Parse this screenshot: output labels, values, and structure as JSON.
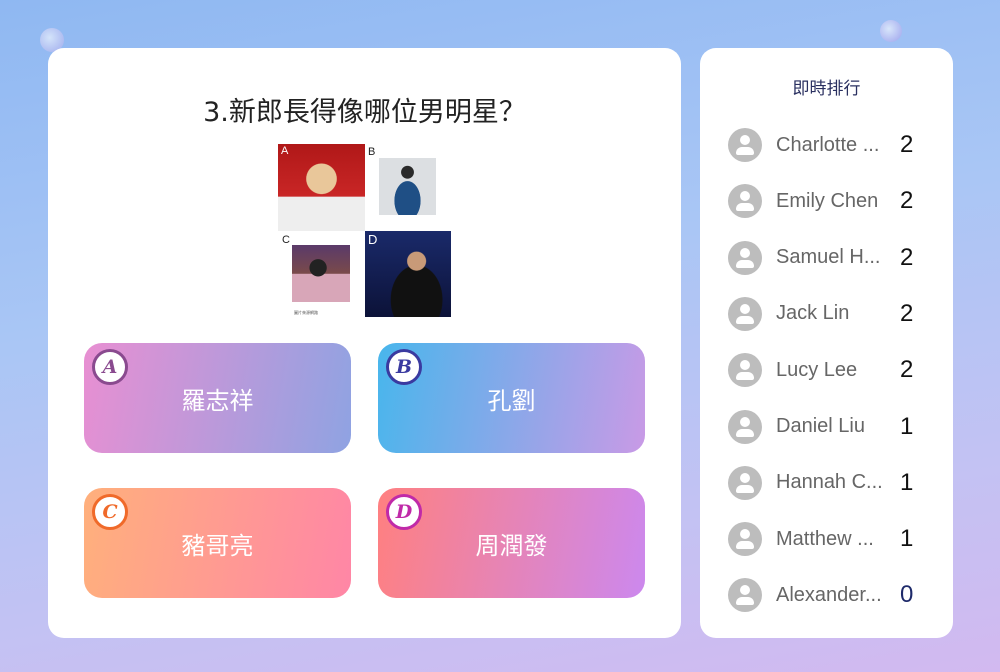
{
  "question": {
    "title": "3.新郎長得像哪位男明星？",
    "image_labels": [
      "A",
      "B",
      "C",
      "D"
    ],
    "image_caption": "圖片來源網路"
  },
  "options": [
    {
      "letter": "A",
      "label": "羅志祥",
      "color_from": "#e88fd2",
      "color_to": "#8fa3e2",
      "badge_color": "#8a4a8f"
    },
    {
      "letter": "B",
      "label": "孔劉",
      "color_from": "#48b6ec",
      "color_to": "#c99ae6",
      "badge_color": "#3a3aa0"
    },
    {
      "letter": "C",
      "label": "豬哥亮",
      "color_from": "#ffb07c",
      "color_to": "#ff86a6",
      "badge_color": "#f06a2a"
    },
    {
      "letter": "D",
      "label": "周潤發",
      "color_from": "#ff8080",
      "color_to": "#cc88ee",
      "badge_color": "#c02aa8"
    }
  ],
  "leaderboard": {
    "title": "即時排行",
    "entries": [
      {
        "name": "Charlotte ...",
        "score": "2"
      },
      {
        "name": "Emily Chen",
        "score": "2"
      },
      {
        "name": "Samuel H...",
        "score": "2"
      },
      {
        "name": "Jack Lin",
        "score": "2"
      },
      {
        "name": "Lucy Lee",
        "score": "2"
      },
      {
        "name": "Daniel Liu",
        "score": "1"
      },
      {
        "name": "Hannah C...",
        "score": "1"
      },
      {
        "name": "Matthew ...",
        "score": "1"
      },
      {
        "name": "Alexander...",
        "score": "0",
        "score_color": "#1e2a6a"
      }
    ]
  }
}
